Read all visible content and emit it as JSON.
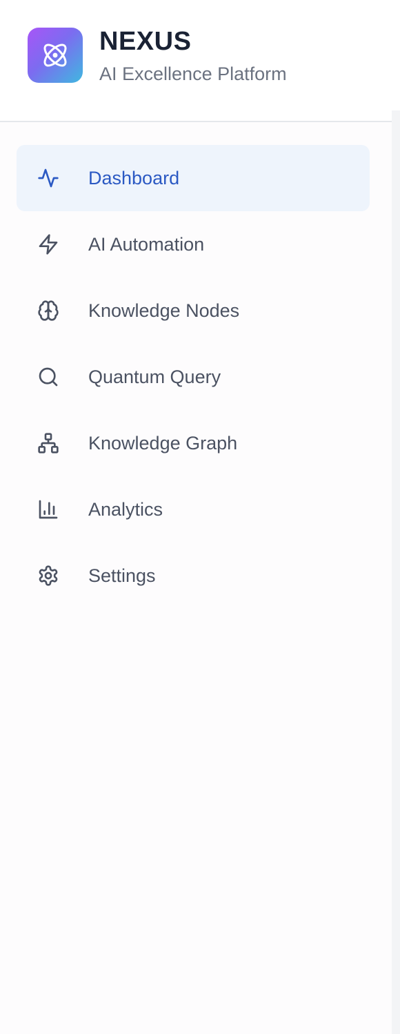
{
  "brand": {
    "title": "NEXUS",
    "subtitle": "AI Excellence Platform",
    "logo_icon": "atom-icon",
    "logo_gradient": [
      "#a855f7",
      "#3fb8e0"
    ]
  },
  "nav": {
    "items": [
      {
        "label": "Dashboard",
        "icon": "activity-icon",
        "active": true
      },
      {
        "label": "AI Automation",
        "icon": "zap-icon",
        "active": false
      },
      {
        "label": "Knowledge Nodes",
        "icon": "brain-icon",
        "active": false
      },
      {
        "label": "Quantum Query",
        "icon": "search-icon",
        "active": false
      },
      {
        "label": "Knowledge Graph",
        "icon": "network-icon",
        "active": false
      },
      {
        "label": "Analytics",
        "icon": "bar-chart-icon",
        "active": false
      },
      {
        "label": "Settings",
        "icon": "gear-icon",
        "active": false
      }
    ]
  },
  "colors": {
    "active_text": "#2b59c3",
    "active_bg": "#eef4fc",
    "inactive_text": "#4b5262",
    "title_text": "#1a2234",
    "subtitle_text": "#6b7280"
  }
}
